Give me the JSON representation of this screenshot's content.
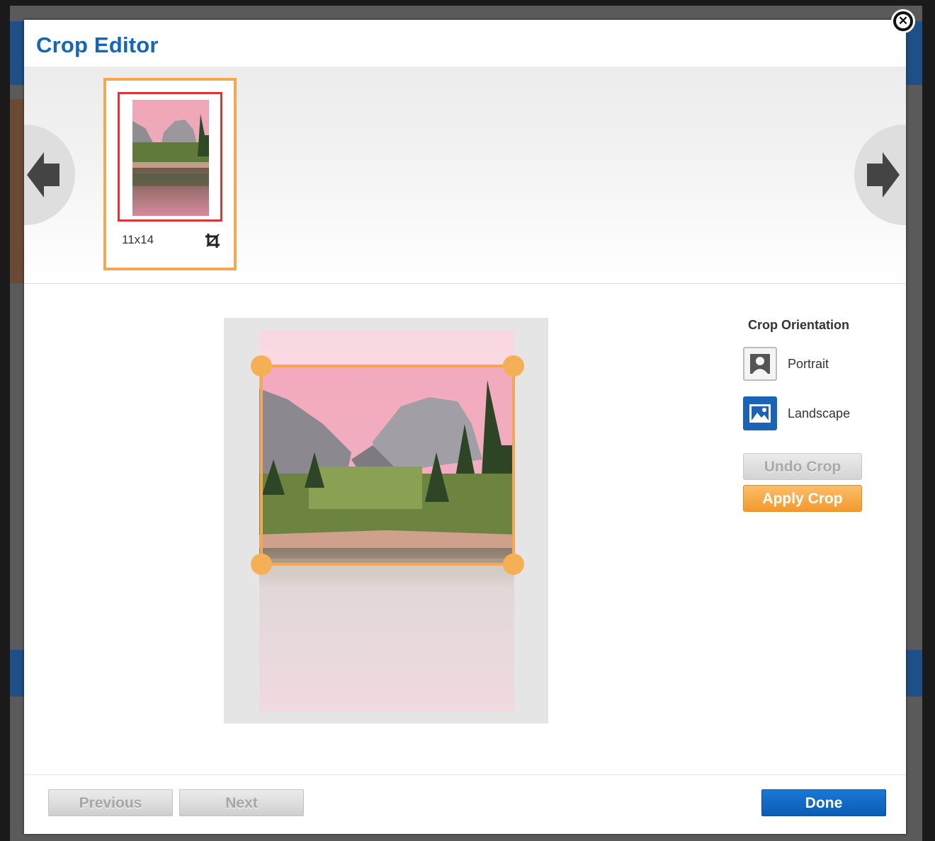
{
  "modal": {
    "title": "Crop Editor",
    "close_icon": "close-icon"
  },
  "carousel": {
    "prev_icon": "arrow-left-icon",
    "next_icon": "arrow-right-icon",
    "items": [
      {
        "size_label": "11x14",
        "crop_icon": "crop-icon",
        "selected": true
      }
    ]
  },
  "preview": {
    "image_description": "Half Dome reflected in river",
    "handles": [
      "top-left",
      "top-right",
      "bottom-left",
      "bottom-right"
    ]
  },
  "orientation": {
    "title": "Crop Orientation",
    "options": [
      {
        "label": "Portrait",
        "icon": "portrait-icon"
      },
      {
        "label": "Landscape",
        "icon": "landscape-icon"
      }
    ]
  },
  "actions": {
    "undo_crop": "Undo Crop",
    "apply_crop": "Apply Crop"
  },
  "footer": {
    "previous": "Previous",
    "next": "Next",
    "done": "Done"
  },
  "colors": {
    "title_blue": "#1565b8",
    "accent_orange": "#f5a651",
    "selected_red": "#d9383a",
    "done_blue": "#0b5cb5"
  }
}
